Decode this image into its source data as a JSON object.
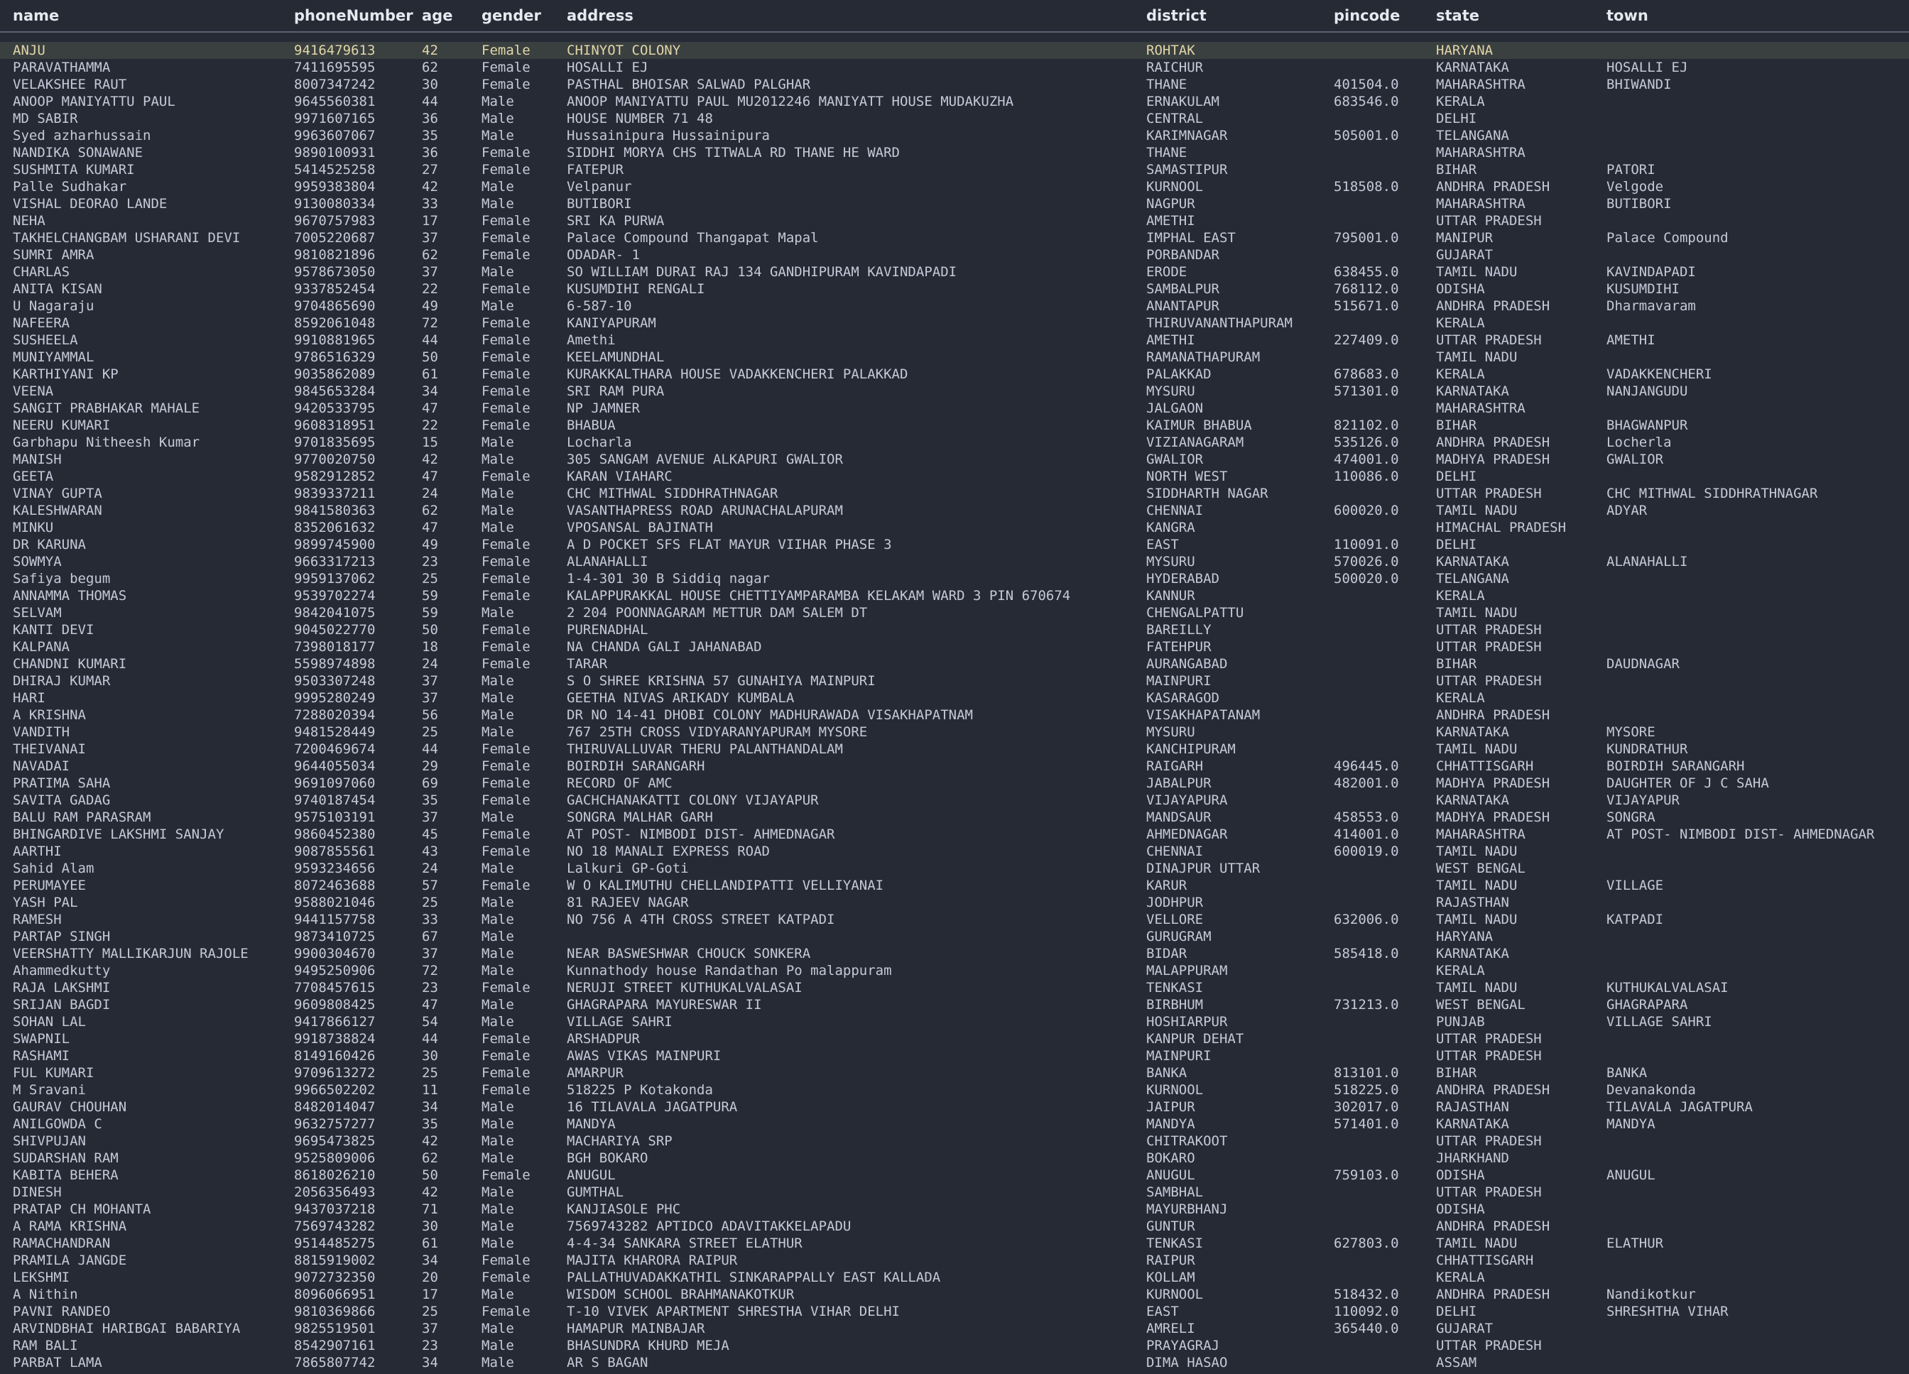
{
  "columns": {
    "name": "name",
    "phoneNumber": "phoneNumber",
    "age": "age",
    "gender": "gender",
    "address": "address",
    "district": "district",
    "pincode": "pincode",
    "state": "state",
    "town": "town"
  },
  "selected_row": 0,
  "rows": [
    [
      "ANJU",
      "9416479613",
      "42",
      "Female",
      "CHINYOT COLONY",
      "ROHTAK",
      "",
      "HARYANA",
      ""
    ],
    [
      "PARAVATHAMMA",
      "7411695595",
      "62",
      "Female",
      "HOSALLI EJ",
      "RAICHUR",
      "",
      "KARNATAKA",
      "HOSALLI EJ"
    ],
    [
      "VELAKSHEE RAUT",
      "8007347242",
      "30",
      "Female",
      "PASTHAL BHOISAR SALWAD PALGHAR",
      "THANE",
      "401504.0",
      "MAHARASHTRA",
      "BHIWANDI"
    ],
    [
      "ANOOP MANIYATTU PAUL",
      "9645560381",
      "44",
      "Male",
      "ANOOP MANIYATTU PAUL MU2012246  MANIYATT HOUSE MUDAKUZHA",
      "ERNAKULAM",
      "683546.0",
      "KERALA",
      ""
    ],
    [
      "MD SABIR",
      "9971607165",
      "36",
      "Male",
      "HOUSE NUMBER 71 48",
      "CENTRAL",
      "",
      "DELHI",
      ""
    ],
    [
      "Syed azharhussain",
      "9963607067",
      "35",
      "Male",
      "Hussainipura  Hussainipura",
      "KARIMNAGAR",
      "505001.0",
      "TELANGANA",
      ""
    ],
    [
      "NANDIKA SONAWANE",
      "9890100931",
      "36",
      "Female",
      "SIDDHI MORYA CHS TITWALA RD THANE  HE WARD",
      "THANE",
      "",
      "MAHARASHTRA",
      ""
    ],
    [
      "SUSHMITA KUMARI",
      "5414525258",
      "27",
      "Female",
      "FATEPUR",
      "SAMASTIPUR",
      "",
      "BIHAR",
      "PATORI"
    ],
    [
      "Palle Sudhakar",
      "9959383804",
      "42",
      "Male",
      "Velpanur",
      "KURNOOL",
      "518508.0",
      "ANDHRA PRADESH",
      "Velgode"
    ],
    [
      "VISHAL DEORAO LANDE",
      "9130080334",
      "33",
      "Male",
      "BUTIBORI",
      "NAGPUR",
      "",
      "MAHARASHTRA",
      "BUTIBORI"
    ],
    [
      "NEHA",
      "9670757983",
      "17",
      "Female",
      "SRI KA PURWA",
      "AMETHI",
      "",
      "UTTAR PRADESH",
      ""
    ],
    [
      "TAKHELCHANGBAM USHARANI DEVI",
      "7005220687",
      "37",
      "Female",
      "Palace Compound Thangapat Mapal",
      "IMPHAL EAST",
      "795001.0",
      "MANIPUR",
      "Palace Compound"
    ],
    [
      "SUMRI AMRA",
      "9810821896",
      "62",
      "Female",
      "ODADAR- 1",
      "PORBANDAR",
      "",
      "GUJARAT",
      ""
    ],
    [
      "CHARLAS",
      "9578673050",
      "37",
      "Male",
      "SO WILLIAM DURAI RAJ 134 GANDHIPURAM KAVINDAPADI",
      "ERODE",
      "638455.0",
      "TAMIL NADU",
      "KAVINDAPADI"
    ],
    [
      "ANITA KISAN",
      "9337852454",
      "22",
      "Female",
      "KUSUMDIHI  RENGALI",
      "SAMBALPUR",
      "768112.0",
      "ODISHA",
      "KUSUMDIHI"
    ],
    [
      "U Nagaraju",
      "9704865690",
      "49",
      "Male",
      "6-587-10",
      "ANANTAPUR",
      "515671.0",
      "ANDHRA PRADESH",
      "Dharmavaram"
    ],
    [
      "NAFEERA",
      "8592061048",
      "72",
      "Female",
      "KANIYAPURAM",
      "THIRUVANANTHAPURAM",
      "",
      "KERALA",
      ""
    ],
    [
      "SUSHEELA",
      "9910881965",
      "44",
      "Female",
      "Amethi",
      "AMETHI",
      "227409.0",
      "UTTAR PRADESH",
      "AMETHI"
    ],
    [
      "MUNIYAMMAL",
      "9786516329",
      "50",
      "Female",
      "KEELAMUNDHAL",
      "RAMANATHAPURAM",
      "",
      "TAMIL NADU",
      ""
    ],
    [
      "KARTHIYANI KP",
      "9035862089",
      "61",
      "Female",
      "KURAKKALTHARA HOUSE  VADAKKENCHERI  PALAKKAD",
      "PALAKKAD",
      "678683.0",
      "KERALA",
      "VADAKKENCHERI"
    ],
    [
      "VEENA",
      "9845653284",
      "34",
      "Female",
      "SRI RAM PURA",
      "MYSURU",
      "571301.0",
      "KARNATAKA",
      "NANJANGUDU"
    ],
    [
      "SANGIT PRABHAKAR MAHALE",
      "9420533795",
      "47",
      "Female",
      "NP JAMNER",
      "JALGAON",
      "",
      "MAHARASHTRA",
      ""
    ],
    [
      "NEERU KUMARI",
      "9608318951",
      "22",
      "Female",
      "BHABUA",
      "KAIMUR  BHABUA",
      "821102.0",
      "BIHAR",
      "BHAGWANPUR"
    ],
    [
      "Garbhapu Nitheesh Kumar",
      "9701835695",
      "15",
      "Male",
      "Locharla",
      "VIZIANAGARAM",
      "535126.0",
      "ANDHRA PRADESH",
      "Locherla"
    ],
    [
      "MANISH",
      "9770020750",
      "42",
      "Male",
      "305 SANGAM AVENUE ALKAPURI  GWALIOR",
      "GWALIOR",
      "474001.0",
      "MADHYA PRADESH",
      "GWALIOR"
    ],
    [
      "GEETA",
      "9582912852",
      "47",
      "Female",
      "KARAN VIAHARC",
      "NORTH WEST",
      "110086.0",
      "DELHI",
      ""
    ],
    [
      "VINAY GUPTA",
      "9839337211",
      "24",
      "Male",
      "CHC MITHWAL SIDDHRATHNAGAR",
      "SIDDHARTH NAGAR",
      "",
      "UTTAR PRADESH",
      "CHC MITHWAL SIDDHRATHNAGAR"
    ],
    [
      "KALESHWARAN",
      "9841580363",
      "62",
      "Male",
      "VASANTHAPRESS ROAD ARUNACHALAPURAM",
      "CHENNAI",
      "600020.0",
      "TAMIL NADU",
      "ADYAR"
    ],
    [
      "MINKU",
      "8352061632",
      "47",
      "Male",
      "VPOSANSAL BAJINATH",
      "KANGRA",
      "",
      "HIMACHAL PRADESH",
      ""
    ],
    [
      "DR KARUNA",
      "9899745900",
      "49",
      "Female",
      "A D POCKET SFS FLAT MAYUR VIIHAR PHASE 3",
      "EAST",
      "110091.0",
      "DELHI",
      ""
    ],
    [
      "SOWMYA",
      "9663317213",
      "23",
      "Female",
      "ALANAHALLI",
      "MYSURU",
      "570026.0",
      "KARNATAKA",
      "ALANAHALLI"
    ],
    [
      "Safiya begum",
      "9959137062",
      "25",
      "Female",
      "1-4-301 30 B Siddiq nagar",
      "HYDERABAD",
      "500020.0",
      "TELANGANA",
      ""
    ],
    [
      "ANNAMMA THOMAS",
      "9539702274",
      "59",
      "Female",
      "KALAPPURAKKAL HOUSE CHETTIYAMPARAMBA  KELAKAM WARD 3  PIN 670674",
      "KANNUR",
      "",
      "KERALA",
      ""
    ],
    [
      "SELVAM",
      "9842041075",
      "59",
      "Male",
      "2 204 POONNAGARAM  METTUR DAM  SALEM DT",
      "CHENGALPATTU",
      "",
      "TAMIL NADU",
      ""
    ],
    [
      "KANTI DEVI",
      "9045022770",
      "50",
      "Female",
      "PURENADHAL",
      "BAREILLY",
      "",
      "UTTAR PRADESH",
      ""
    ],
    [
      "KALPANA",
      "7398018177",
      "18",
      "Female",
      "NA CHANDA GALI JAHANABAD",
      "FATEHPUR",
      "",
      "UTTAR PRADESH",
      ""
    ],
    [
      "CHANDNI KUMARI",
      "5598974898",
      "24",
      "Female",
      "TARAR",
      "AURANGABAD",
      "",
      "BIHAR",
      "DAUDNAGAR"
    ],
    [
      "DHIRAJ KUMAR",
      "9503307248",
      "37",
      "Male",
      "S O SHREE KRISHNA 57 GUNAHIYA MAINPURI",
      "MAINPURI",
      "",
      "UTTAR PRADESH",
      ""
    ],
    [
      "HARI",
      "9995280249",
      "37",
      "Male",
      "GEETHA NIVAS   ARIKADY   KUMBALA",
      "KASARAGOD",
      "",
      "KERALA",
      ""
    ],
    [
      "A KRISHNA",
      "7288020394",
      "56",
      "Male",
      "DR   NO   14-41  DHOBI COLONY   MADHURAWADA   VISAKHAPATNAM",
      "VISAKHAPATANAM",
      "",
      "ANDHRA PRADESH",
      ""
    ],
    [
      "VANDITH",
      "9481528449",
      "25",
      "Male",
      "767 25TH CROSS VIDYARANYAPURAM MYSORE",
      "MYSURU",
      "",
      "KARNATAKA",
      "MYSORE"
    ],
    [
      "THEIVANAI",
      "7200469674",
      "44",
      "Female",
      "THIRUVALLUVAR THERU PALANTHANDALAM",
      "KANCHIPURAM",
      "",
      "TAMIL NADU",
      "KUNDRATHUR"
    ],
    [
      "NAVADAI",
      "9644055034",
      "29",
      "Female",
      "BOIRDIH SARANGARH",
      "RAIGARH",
      "496445.0",
      "CHHATTISGARH",
      "BOIRDIH SARANGARH"
    ],
    [
      "PRATIMA SAHA",
      "9691097060",
      "69",
      "Female",
      "RECORD OF AMC",
      "JABALPUR",
      "482001.0",
      "MADHYA PRADESH",
      "DAUGHTER OF J C SAHA"
    ],
    [
      "SAVITA GADAG",
      "9740187454",
      "35",
      "Female",
      "GACHCHANAKATTI COLONY VIJAYAPUR",
      "VIJAYAPURA",
      "",
      "KARNATAKA",
      "VIJAYAPUR"
    ],
    [
      "BALU RAM PARASRAM",
      "9575103191",
      "37",
      "Male",
      "SONGRA MALHAR GARH",
      "MANDSAUR",
      "458553.0",
      "MADHYA PRADESH",
      "SONGRA"
    ],
    [
      "BHINGARDIVE LAKSHMI SANJAY",
      "9860452380",
      "45",
      "Female",
      "AT POST- NIMBODI DIST- AHMEDNAGAR",
      "AHMEDNAGAR",
      "414001.0",
      "MAHARASHTRA",
      "AT POST- NIMBODI DIST- AHMEDNAGAR"
    ],
    [
      "AARTHI",
      "9087855561",
      "43",
      "Female",
      "NO 18 MANALI EXPRESS ROAD",
      "CHENNAI",
      "600019.0",
      "TAMIL NADU",
      ""
    ],
    [
      "Sahid Alam",
      "9593234656",
      "24",
      "Male",
      "Lalkuri GP-Goti",
      "DINAJPUR UTTAR",
      "",
      "WEST BENGAL",
      ""
    ],
    [
      "PERUMAYEE",
      "8072463688",
      "57",
      "Female",
      "W  O KALIMUTHU  CHELLANDIPATTI   VELLIYANAI",
      "KARUR",
      "",
      "TAMIL NADU",
      "VILLAGE"
    ],
    [
      "YASH PAL",
      "9588021046",
      "25",
      "Male",
      "81 RAJEEV NAGAR",
      "JODHPUR",
      "",
      "RAJASTHAN",
      ""
    ],
    [
      "RAMESH",
      "9441157758",
      "33",
      "Male",
      "NO 756 A 4TH CROSS STREET KATPADI",
      "VELLORE",
      "632006.0",
      "TAMIL NADU",
      "KATPADI"
    ],
    [
      "PARTAP SINGH",
      "9873410725",
      "67",
      "Male",
      "",
      "GURUGRAM",
      "",
      "HARYANA",
      ""
    ],
    [
      "VEERSHATTY MALLIKARJUN RAJOLE",
      "9900304670",
      "37",
      "Male",
      "NEAR BASWESHWAR CHOUCK SONKERA",
      "BIDAR",
      "585418.0",
      "KARNATAKA",
      ""
    ],
    [
      "Ahammedkutty",
      "9495250906",
      "72",
      "Male",
      "Kunnathody house Randathan Po malappuram",
      "MALAPPURAM",
      "",
      "KERALA",
      ""
    ],
    [
      "RAJA LAKSHMI",
      "7708457615",
      "23",
      "Female",
      "NERUJI STREET KUTHUKALVALASAI",
      "TENKASI",
      "",
      "TAMIL NADU",
      "KUTHUKALVALASAI"
    ],
    [
      "SRIJAN BAGDI",
      "9609808425",
      "47",
      "Male",
      "GHAGRAPARA MAYURESWAR II",
      "BIRBHUM",
      "731213.0",
      "WEST BENGAL",
      "GHAGRAPARA"
    ],
    [
      "SOHAN LAL",
      "9417866127",
      "54",
      "Male",
      "VILLAGE SAHRI",
      "HOSHIARPUR",
      "",
      "PUNJAB",
      "VILLAGE SAHRI"
    ],
    [
      "SWAPNIL",
      "9918738824",
      "44",
      "Female",
      "ARSHADPUR",
      "KANPUR DEHAT",
      "",
      "UTTAR PRADESH",
      ""
    ],
    [
      "RASHAMI",
      "8149160426",
      "30",
      "Female",
      "AWAS VIKAS MAINPURI",
      "MAINPURI",
      "",
      "UTTAR PRADESH",
      ""
    ],
    [
      "FUL KUMARI",
      "9709613272",
      "25",
      "Female",
      "AMARPUR",
      "BANKA",
      "813101.0",
      "BIHAR",
      "BANKA"
    ],
    [
      "M Sravani",
      "9966502202",
      "11",
      "Female",
      "518225 P Kotakonda",
      "KURNOOL",
      "518225.0",
      "ANDHRA PRADESH",
      "Devanakonda"
    ],
    [
      "GAURAV CHOUHAN",
      "8482014047",
      "34",
      "Male",
      "16 TILAVALA JAGATPURA",
      "JAIPUR",
      "302017.0",
      "RAJASTHAN",
      "TILAVALA JAGATPURA"
    ],
    [
      "ANILGOWDA C",
      "9632757277",
      "35",
      "Male",
      "MANDYA",
      "MANDYA",
      "571401.0",
      "KARNATAKA",
      "MANDYA"
    ],
    [
      "SHIVPUJAN",
      "9695473825",
      "42",
      "Male",
      "MACHARIYA SRP",
      "CHITRAKOOT",
      "",
      "UTTAR PRADESH",
      ""
    ],
    [
      "SUDARSHAN RAM",
      "9525809006",
      "62",
      "Male",
      "BGH BOKARO",
      "BOKARO",
      "",
      "JHARKHAND",
      ""
    ],
    [
      "KABITA BEHERA",
      "8618026210",
      "50",
      "Female",
      "ANUGUL",
      "ANUGUL",
      "759103.0",
      "ODISHA",
      "ANUGUL"
    ],
    [
      "DINESH",
      "2056356493",
      "42",
      "Male",
      "GUMTHAL",
      "SAMBHAL",
      "",
      "UTTAR PRADESH",
      ""
    ],
    [
      "PRATAP CH MOHANTA",
      "9437037218",
      "71",
      "Male",
      "KANJIASOLE PHC",
      "MAYURBHANJ",
      "",
      "ODISHA",
      ""
    ],
    [
      "A RAMA KRISHNA",
      "7569743282",
      "30",
      "Male",
      "7569743282 APTIDCO ADAVITAKKELAPADU",
      "GUNTUR",
      "",
      "ANDHRA PRADESH",
      ""
    ],
    [
      "RAMACHANDRAN",
      "9514485275",
      "61",
      "Male",
      "4-4-34 SANKARA STREET  ELATHUR",
      "TENKASI",
      "627803.0",
      "TAMIL NADU",
      "ELATHUR"
    ],
    [
      "PRAMILA  JANGDE",
      "8815919002",
      "34",
      "Female",
      "MAJITA KHARORA RAIPUR",
      "RAIPUR",
      "",
      "CHHATTISGARH",
      ""
    ],
    [
      "LEKSHMI",
      "9072732350",
      "20",
      "Female",
      "PALLATHUVADAKKATHIL SINKARAPPALLY EAST KALLADA",
      "KOLLAM",
      "",
      "KERALA",
      ""
    ],
    [
      "A Nithin",
      "8096066951",
      "17",
      "Male",
      "WISDOM SCHOOL  BRAHMANAKOTKUR",
      "KURNOOL",
      "518432.0",
      "ANDHRA PRADESH",
      "Nandikotkur"
    ],
    [
      "PAVNI RANDEO",
      "9810369866",
      "25",
      "Female",
      "T-10 VIVEK APARTMENT SHRESTHA VIHAR DELHI",
      "EAST",
      "110092.0",
      "DELHI",
      "SHRESHTHA VIHAR"
    ],
    [
      "ARVINDBHAI HARIBGAI BABARIYA",
      "9825519501",
      "37",
      "Male",
      "HAMAPUR MAINBAJAR",
      "AMRELI",
      "365440.0",
      "GUJARAT",
      ""
    ],
    [
      "RAM BALI",
      "8542907161",
      "23",
      "Male",
      "BHASUNDRA KHURD MEJA",
      "PRAYAGRAJ",
      "",
      "UTTAR PRADESH",
      ""
    ],
    [
      "PARBAT LAMA",
      "7865807742",
      "34",
      "Male",
      "AR S BAGAN",
      "DIMA HASAO",
      "",
      "ASSAM",
      ""
    ]
  ]
}
